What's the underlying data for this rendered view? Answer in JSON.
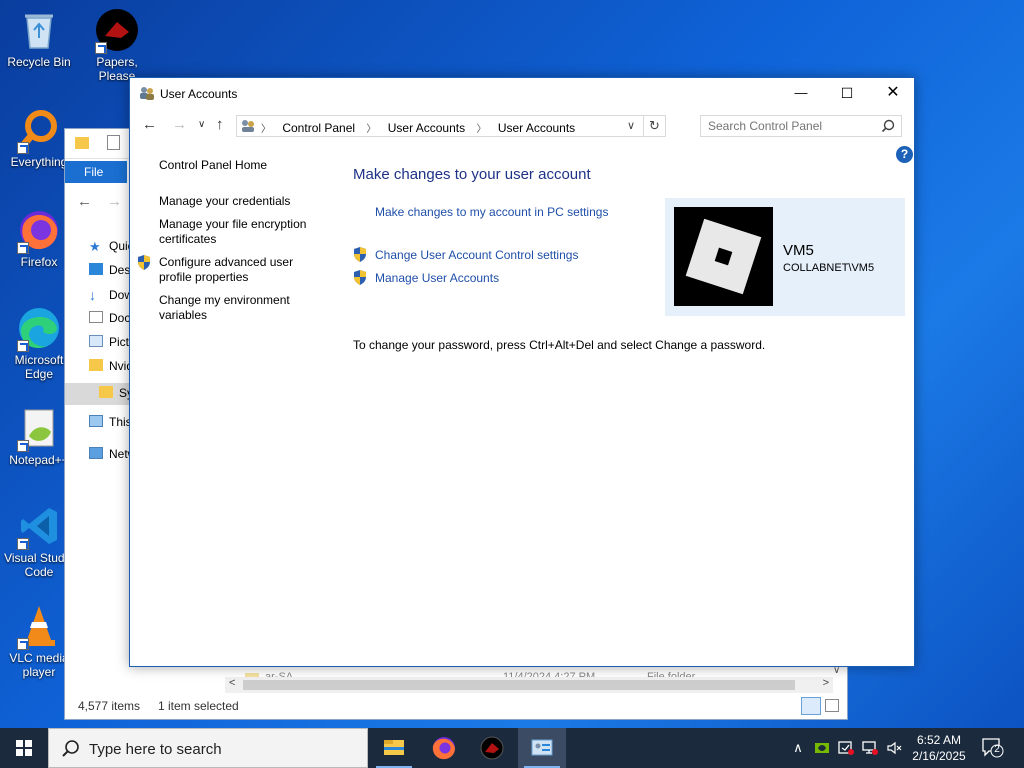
{
  "desktop": {
    "icons": [
      {
        "label": "Recycle Bin"
      },
      {
        "label": "Papers, Please"
      },
      {
        "label": "Everything"
      },
      {
        "label": "Firefox"
      },
      {
        "label": "Microsoft Edge"
      },
      {
        "label": "Notepad++"
      },
      {
        "label": "Visual Studio Code"
      },
      {
        "label": "VLC media player"
      }
    ]
  },
  "explorer": {
    "file_tab": "File",
    "nav_items": [
      "Quick access",
      "Desktop",
      "Downloads",
      "Documents",
      "Pictures",
      "Nvidia",
      "System",
      "This PC",
      "Network"
    ],
    "faded_row": {
      "name": "ar-SA",
      "date": "11/4/2024 4:27 PM",
      "type": "File folder"
    },
    "status": {
      "count": "4,577 items",
      "selection": "1 item selected"
    }
  },
  "window": {
    "title": "User Accounts",
    "controls": {
      "minimize": "—",
      "maximize": "☐",
      "close": "✕"
    },
    "breadcrumb": [
      "Control Panel",
      "User Accounts",
      "User Accounts"
    ],
    "search_placeholder": "Search Control Panel",
    "left_links": [
      "Control Panel Home",
      "Manage your credentials",
      "Manage your file encryption certificates",
      "Configure advanced user profile properties",
      "Change my environment variables"
    ],
    "heading": "Make changes to your user account",
    "links": {
      "pc_settings": "Make changes to my account in PC settings",
      "uac": "Change User Account Control settings",
      "manage": "Manage User Accounts"
    },
    "note": "To change your password, press Ctrl+Alt+Del and select Change a password.",
    "account": {
      "name": "VM5",
      "domain": "COLLABNET\\VM5"
    }
  },
  "taskbar": {
    "search_placeholder": "Type here to search",
    "clock": {
      "time": "6:52 AM",
      "date": "2/16/2025"
    },
    "notification_count": "2"
  },
  "colors": {
    "accent": "#1a6fd1",
    "link": "#1f4fa8",
    "heading": "#1e3287",
    "taskbar": "#1c2a3d"
  }
}
